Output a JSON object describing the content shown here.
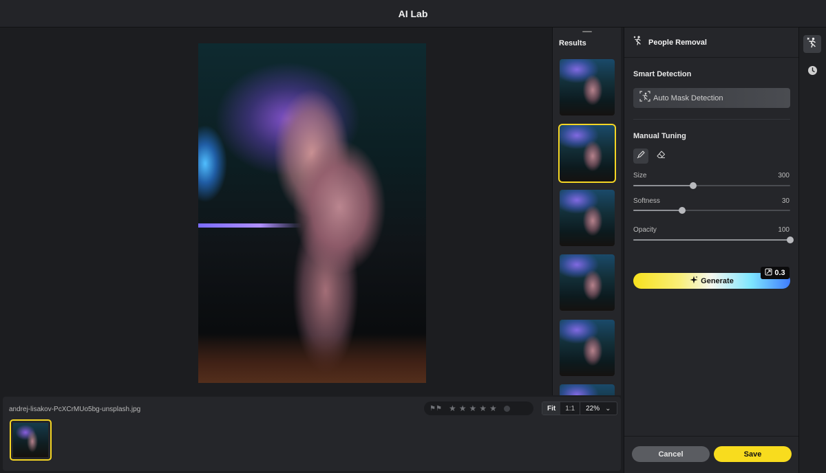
{
  "window": {
    "title": "AI Lab"
  },
  "results": {
    "label": "Results",
    "selected_index": 1
  },
  "panel": {
    "title": "People Removal",
    "smart_detection": {
      "title": "Smart Detection",
      "auto_mask_label": "Auto Mask Detection"
    },
    "manual_tuning": {
      "title": "Manual Tuning",
      "tools": [
        "brush-icon",
        "eraser-icon"
      ],
      "size": {
        "label": "Size",
        "value": "300",
        "fraction": 0.38
      },
      "softness": {
        "label": "Softness",
        "value": "30",
        "fraction": 0.31
      },
      "opacity": {
        "label": "Opacity",
        "value": "100",
        "fraction": 1.0
      }
    },
    "generate": {
      "label": "Generate",
      "credits": "0.3"
    },
    "footer": {
      "cancel_label": "Cancel",
      "save_label": "Save"
    }
  },
  "filmstrip": {
    "filename": "andrej-lisakov-PcXCrMUo5bg-unsplash.jpg",
    "rating": {
      "stars": 0,
      "max": 5
    },
    "zoom": {
      "fit_label": "Fit",
      "one_to_one_label": "1:1",
      "value": "22%"
    }
  },
  "colors": {
    "accent": "#f8dc1e",
    "background": "#1c1d20",
    "panel": "#25262a"
  }
}
